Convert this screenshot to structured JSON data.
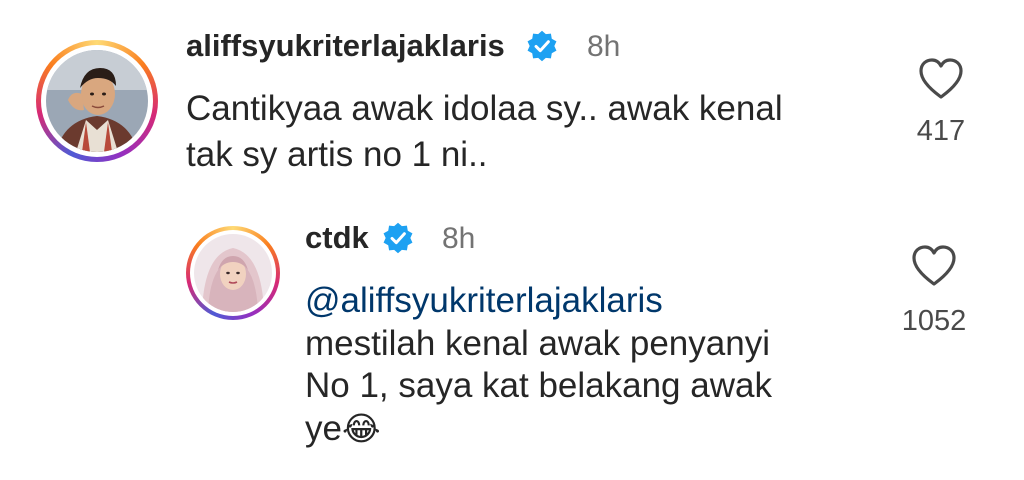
{
  "comments": [
    {
      "username": "aliffsyukriterlajaklaris",
      "time": "8h",
      "text_line1": "Cantikyaa awak idolaa sy.. awak kenal",
      "text_line2": "tak sy artis no 1 ni..",
      "likes": "417"
    },
    {
      "username": "ctdk",
      "time": "8h",
      "mention": "@aliffsyukriterlajaklaris",
      "text_line1": "mestilah kenal awak penyanyi",
      "text_line2": "No 1, saya kat belakang awak",
      "text_line3": "ye",
      "emoji": "😂",
      "likes": "1052"
    }
  ],
  "colors": {
    "verified": "#1da1f2",
    "mention": "#00376b",
    "time": "#737373"
  },
  "icons": [
    "verified-badge-icon",
    "heart-outline-icon"
  ]
}
